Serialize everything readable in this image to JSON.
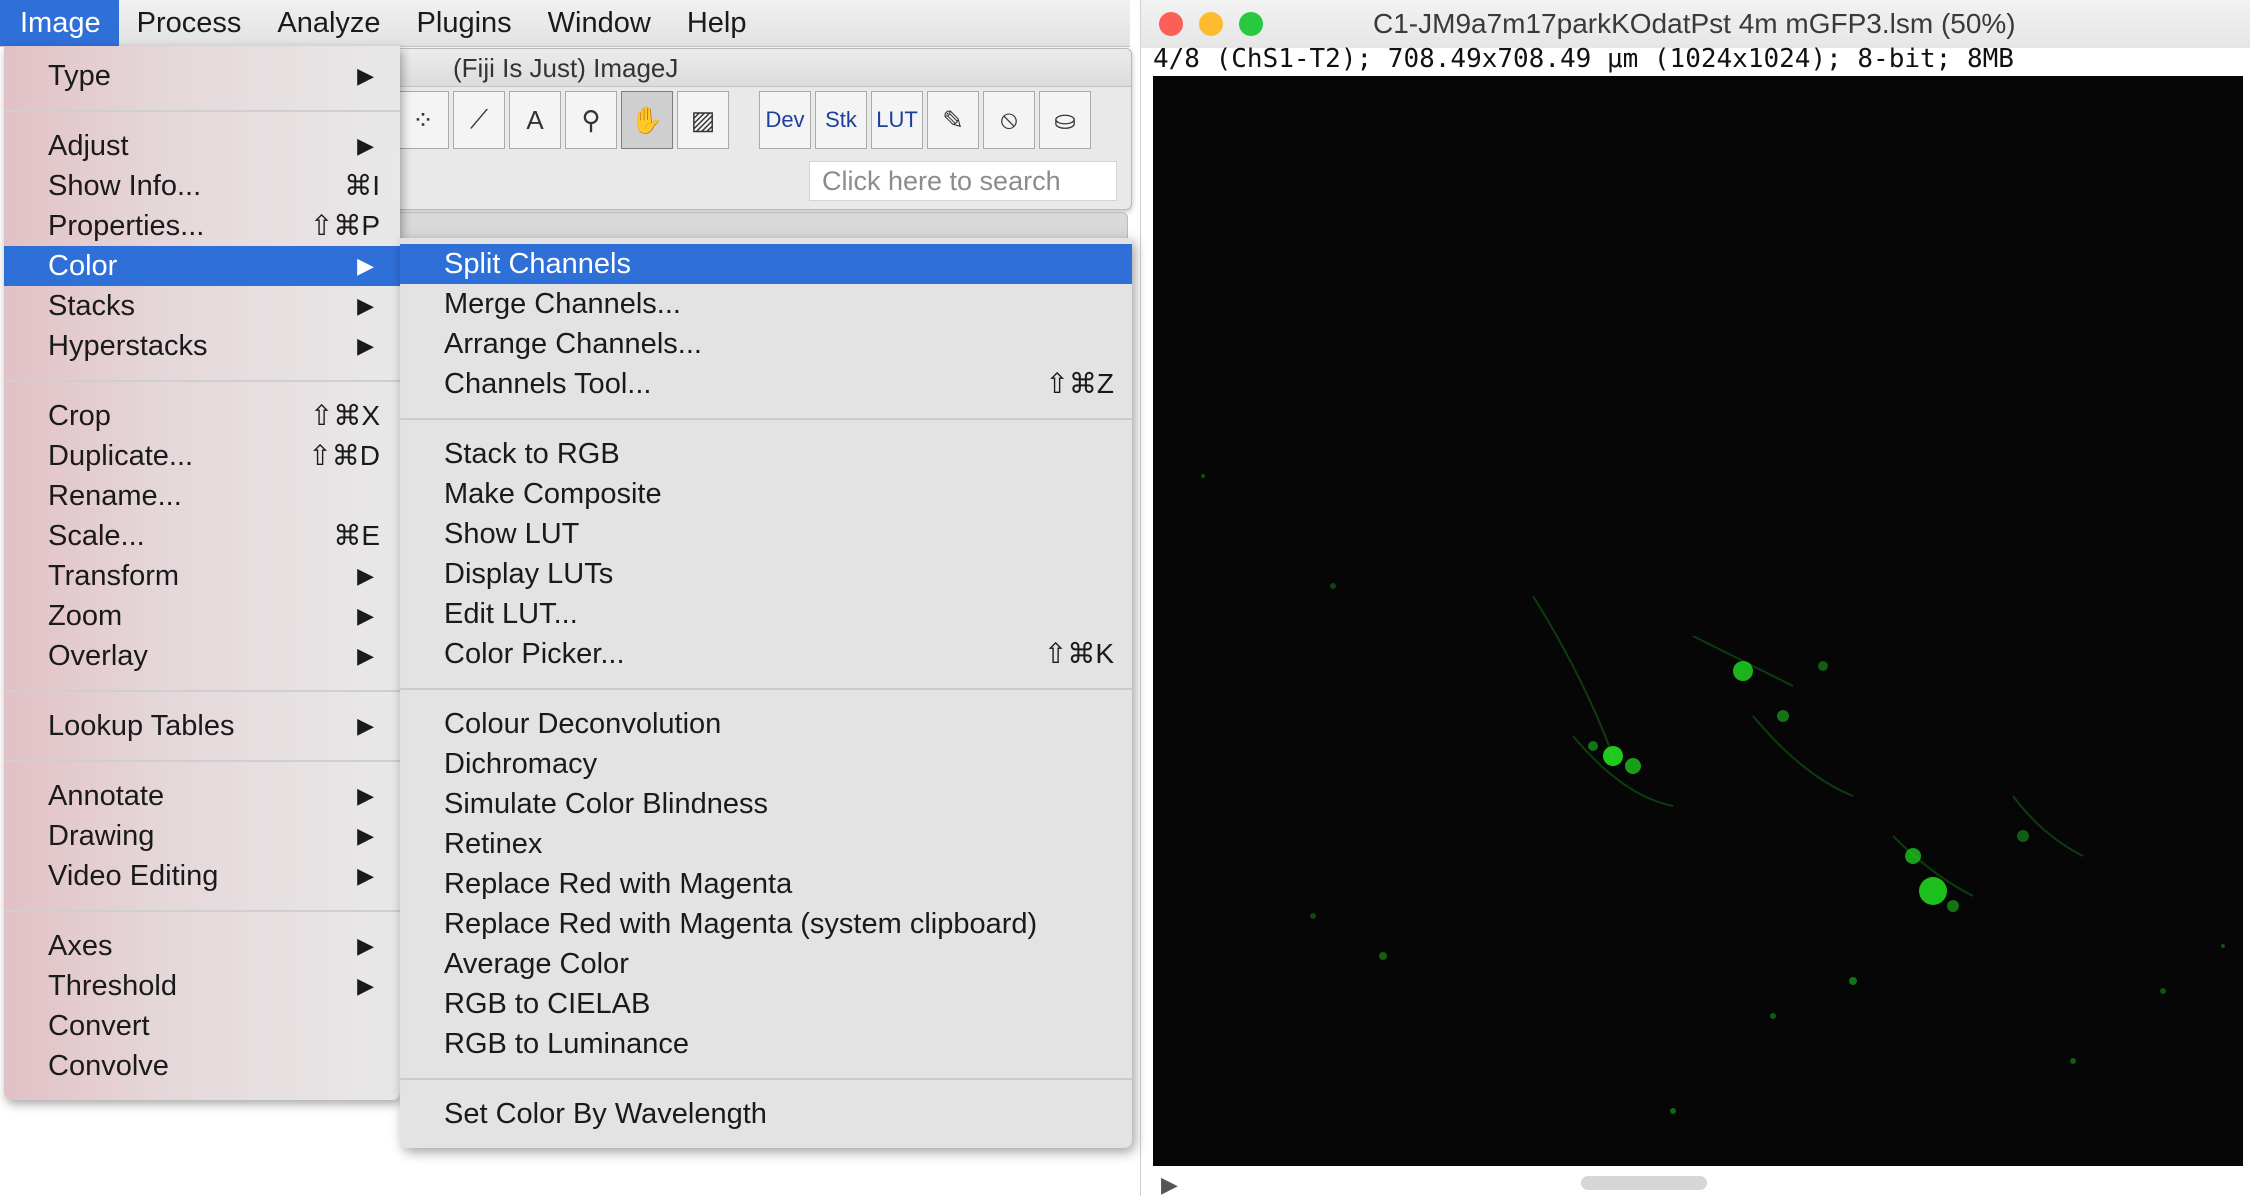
{
  "menubar": {
    "items": [
      "Image",
      "Process",
      "Analyze",
      "Plugins",
      "Window",
      "Help"
    ],
    "active": "Image"
  },
  "imagej": {
    "title": "(Fiji Is Just) ImageJ",
    "tools": [
      {
        "name": "selection-icon",
        "glyph": "⁘"
      },
      {
        "name": "wand-icon",
        "glyph": "⟋"
      },
      {
        "name": "text-tool-icon",
        "glyph": "A"
      },
      {
        "name": "magnifier-icon",
        "glyph": "⚲"
      },
      {
        "name": "hand-icon",
        "glyph": "✋"
      },
      {
        "name": "color-picker-icon",
        "glyph": "▨"
      },
      {
        "name": "dev-tool",
        "glyph": "Dev"
      },
      {
        "name": "stk-tool",
        "glyph": "Stk"
      },
      {
        "name": "lut-tool",
        "glyph": "LUT"
      },
      {
        "name": "pencil-icon",
        "glyph": "✎"
      },
      {
        "name": "brush-icon",
        "glyph": "⦸"
      },
      {
        "name": "flood-fill-icon",
        "glyph": "⛀"
      }
    ],
    "search_placeholder": "Click here to search"
  },
  "image_menu": {
    "items": [
      {
        "label": "Type",
        "shortcut": "",
        "submenu": true
      },
      {
        "label": "Adjust",
        "shortcut": "",
        "submenu": true
      },
      {
        "label": "Show Info...",
        "shortcut": "⌘I",
        "submenu": false
      },
      {
        "label": "Properties...",
        "shortcut": "⇧⌘P",
        "submenu": false
      },
      {
        "label": "Color",
        "shortcut": "",
        "submenu": true,
        "highlighted": true
      },
      {
        "label": "Stacks",
        "shortcut": "",
        "submenu": true
      },
      {
        "label": "Hyperstacks",
        "shortcut": "",
        "submenu": true
      },
      {
        "label": "Crop",
        "shortcut": "⇧⌘X",
        "submenu": false
      },
      {
        "label": "Duplicate...",
        "shortcut": "⇧⌘D",
        "submenu": false
      },
      {
        "label": "Rename...",
        "shortcut": "",
        "submenu": false
      },
      {
        "label": "Scale...",
        "shortcut": "⌘E",
        "submenu": false
      },
      {
        "label": "Transform",
        "shortcut": "",
        "submenu": true
      },
      {
        "label": "Zoom",
        "shortcut": "",
        "submenu": true
      },
      {
        "label": "Overlay",
        "shortcut": "",
        "submenu": true
      },
      {
        "label": "Lookup Tables",
        "shortcut": "",
        "submenu": true
      },
      {
        "label": "Annotate",
        "shortcut": "",
        "submenu": true
      },
      {
        "label": "Drawing",
        "shortcut": "",
        "submenu": true
      },
      {
        "label": "Video Editing",
        "shortcut": "",
        "submenu": true
      },
      {
        "label": "Axes",
        "shortcut": "",
        "submenu": true
      },
      {
        "label": "Threshold",
        "shortcut": "",
        "submenu": true
      },
      {
        "label": "Convert",
        "shortcut": "",
        "submenu": false
      },
      {
        "label": "Convolve",
        "shortcut": "",
        "submenu": false
      }
    ]
  },
  "color_menu": {
    "items": [
      {
        "label": "Split Channels",
        "shortcut": "",
        "highlighted": true
      },
      {
        "label": "Merge Channels...",
        "shortcut": ""
      },
      {
        "label": "Arrange Channels...",
        "shortcut": ""
      },
      {
        "label": "Channels Tool...",
        "shortcut": "⇧⌘Z"
      },
      {
        "label": "Stack to RGB",
        "shortcut": ""
      },
      {
        "label": "Make Composite",
        "shortcut": ""
      },
      {
        "label": "Show LUT",
        "shortcut": ""
      },
      {
        "label": "Display LUTs",
        "shortcut": ""
      },
      {
        "label": "Edit LUT...",
        "shortcut": ""
      },
      {
        "label": "Color Picker...",
        "shortcut": "⇧⌘K"
      },
      {
        "label": "Colour Deconvolution",
        "shortcut": ""
      },
      {
        "label": "Dichromacy",
        "shortcut": ""
      },
      {
        "label": "Simulate Color Blindness",
        "shortcut": ""
      },
      {
        "label": "Retinex",
        "shortcut": ""
      },
      {
        "label": "Replace Red with Magenta",
        "shortcut": ""
      },
      {
        "label": "Replace Red with Magenta (system clipboard)",
        "shortcut": ""
      },
      {
        "label": "Average Color",
        "shortcut": ""
      },
      {
        "label": "RGB to CIELAB",
        "shortcut": ""
      },
      {
        "label": "RGB to Luminance",
        "shortcut": ""
      },
      {
        "label": "Set Color By Wavelength",
        "shortcut": ""
      }
    ]
  },
  "image_window": {
    "title": "C1-JM9a7m17parkKOdatPst 4m mGFP3.lsm (50%)",
    "info": "4/8 (ChS1-T2); 708.49x708.49 μm (1024x1024); 8-bit; 8MB",
    "traffic_lights": [
      "#fc5f57",
      "#fdbc2e",
      "#28c840"
    ],
    "signal_color": "#22e022",
    "background_color": "#060606"
  },
  "colors": {
    "accent": "#2f6fd8"
  }
}
